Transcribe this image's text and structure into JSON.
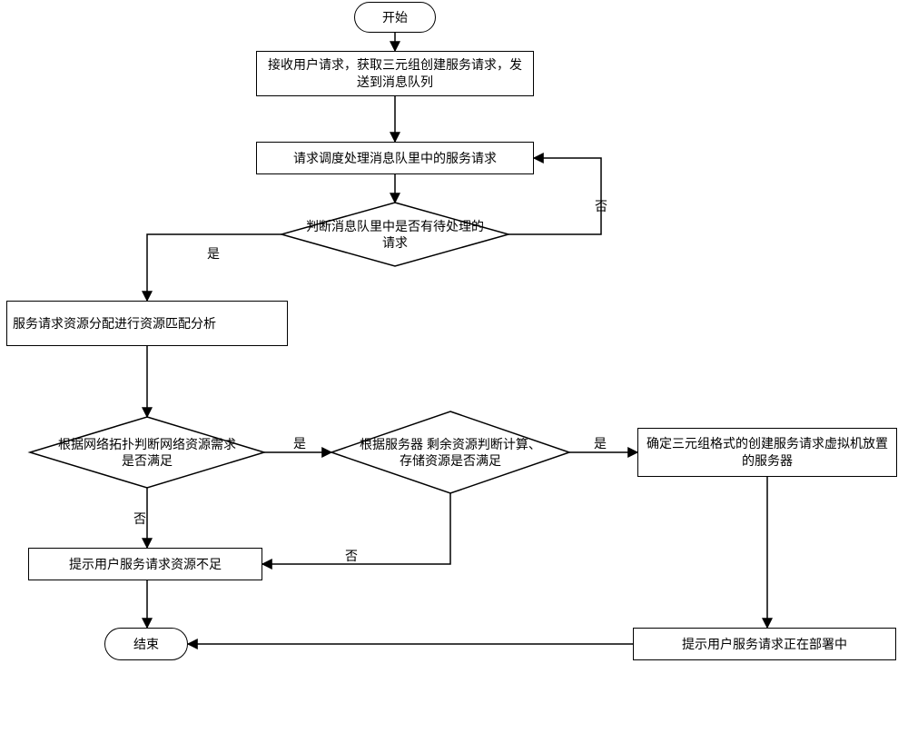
{
  "nodes": {
    "start": "开始",
    "receive": "接收用户请求，获取三元组创建服务请求，发送到消息队列",
    "schedule": "请求调度处理消息队里中的服务请求",
    "hasPending": "判断消息队里中是否有待处理的请求",
    "matchAnalyze": "服务请求资源分配进行资源匹配分析",
    "netSatisfy": "根据网络拓扑判断网络资源需求是否满足",
    "srvSatisfy": "根据服务器 剩余资源判断计算、存储资源是否满足",
    "placeServer": "确定三元组格式的创建服务请求虚拟机放置的服务器",
    "notEnough": "提示用户服务请求资源不足",
    "deploying": "提示用户服务请求正在部署中",
    "end": "结束"
  },
  "labels": {
    "yes": "是",
    "no": "否"
  }
}
